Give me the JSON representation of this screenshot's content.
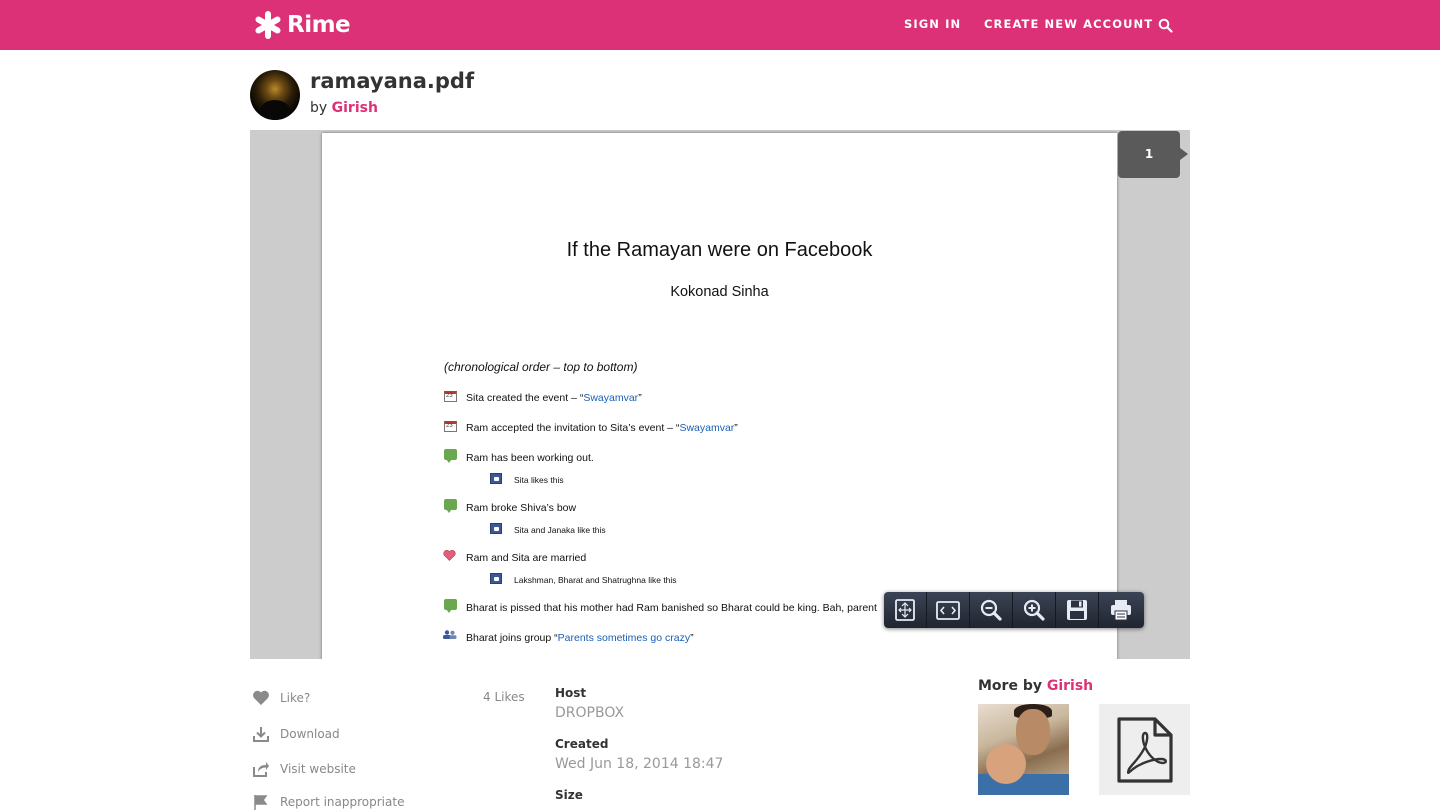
{
  "header": {
    "brand": "Rime",
    "nav": {
      "sign_in": "SIGN IN",
      "create_account": "CREATE NEW ACCOUNT"
    },
    "brand_color": "#dc3176"
  },
  "document": {
    "title": "ramayana.pdf",
    "by_prefix": "by",
    "author": "Girish"
  },
  "viewer": {
    "page_indicator": "1",
    "page": {
      "title": "If the Ramayan were on Facebook",
      "author": "Kokonad Sinha",
      "order_note": "(chronological order – top to bottom)",
      "entries": [
        {
          "icon": "calendar-icon",
          "text": "Sita created the event – “",
          "link": "Swayamvar",
          "tail": "”"
        },
        {
          "icon": "calendar-icon",
          "text": "Ram accepted the invitation to Sita’s event – “",
          "link": "Swayamvar",
          "tail": "”"
        },
        {
          "icon": "wall-post-icon",
          "text": "Ram has been working out.",
          "sub": "Sita likes this"
        },
        {
          "icon": "wall-post-icon",
          "text": "Ram broke Shiva’s bow",
          "sub": "Sita and Janaka like this"
        },
        {
          "icon": "heart-icon",
          "text": "Ram and Sita are married",
          "sub": "Lakshman, Bharat and Shatrughna like this"
        },
        {
          "icon": "wall-post-icon",
          "text": "Bharat is pissed that his mother had Ram banished so Bharat could be king. Bah, parent"
        },
        {
          "icon": "group-icon",
          "text": "Bharat joins group “",
          "link": "Parents sometimes go crazy",
          "tail": "”"
        }
      ]
    },
    "toolbar": [
      "fit-page",
      "prev-next-page",
      "zoom-out",
      "zoom-in",
      "save",
      "print"
    ]
  },
  "actions": {
    "like": "Like?",
    "likes_count": "4 Likes",
    "download": "Download",
    "visit": "Visit website",
    "report": "Report inappropriate"
  },
  "meta": {
    "host_label": "Host",
    "host_value": "DROPBOX",
    "created_label": "Created",
    "created_value": "Wed Jun 18, 2014 18:47",
    "size_label": "Size"
  },
  "more": {
    "prefix": "More by",
    "author": "Girish"
  }
}
